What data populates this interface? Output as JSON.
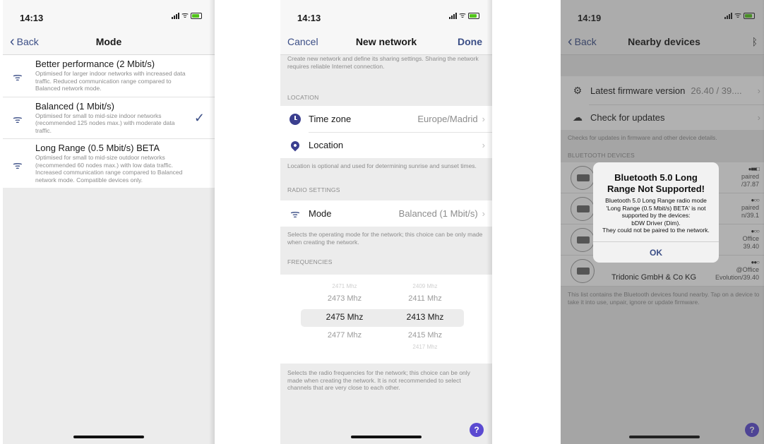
{
  "screen1": {
    "status_time": "14:13",
    "back_label": "Back",
    "title": "Mode",
    "modes": [
      {
        "title": "Better performance (2 Mbit/s)",
        "description": "Optimised for larger indoor networks with increased data traffic. Reduced communication range compared to Balanced network mode.",
        "selected": false
      },
      {
        "title": "Balanced (1 Mbit/s)",
        "description": "Optimised for small to mid-size indoor networks (recommended 125 nodes max.) with moderate data traffic.",
        "selected": true
      },
      {
        "title": "Long Range (0.5 Mbit/s) BETA",
        "description": "Optimised for small to mid-size outdoor networks (recommended 60 nodes max.) with low data traffic. Increased communication range compared to Balanced network mode. Compatible devices only.",
        "selected": false
      }
    ]
  },
  "screen2": {
    "status_time": "14:13",
    "cancel_label": "Cancel",
    "title": "New network",
    "done_label": "Done",
    "intro": "Create new network and define its sharing settings. Sharing the network requires reliable Internet connection.",
    "location_header": "LOCATION",
    "timezone_label": "Time zone",
    "timezone_value": "Europe/Madrid",
    "location_label": "Location",
    "location_note": "Location is optional and used for determining sunrise and sunset times.",
    "radio_header": "RADIO SETTINGS",
    "mode_label": "Mode",
    "mode_value": "Balanced (1 Mbit/s)",
    "mode_note": "Selects the operating mode for the network; this choice can be only made when creating the network.",
    "frequencies_header": "FREQUENCIES",
    "picker_left": [
      "2471 Mhz",
      "2473 Mhz",
      "2475 Mhz",
      "2477 Mhz",
      ""
    ],
    "picker_right": [
      "2409 Mhz",
      "2411 Mhz",
      "2413 Mhz",
      "2415 Mhz",
      "2417 Mhz"
    ],
    "frequencies_note": "Selects the radio frequencies for the network; this choice can be only made when creating the network. It is not recommended to select channels that are very close to each other.",
    "help_label": "?"
  },
  "screen3": {
    "status_time": "14:19",
    "back_label": "Back",
    "title": "Nearby devices",
    "firmware_label": "Latest firmware version",
    "firmware_value": "26.40 / 39....",
    "updates_label": "Check for updates",
    "updates_note": "Checks for updates in firmware and other device details.",
    "devices_header": "BLUETOOTH DEVICES",
    "devices": [
      {
        "name": "",
        "status": "paired",
        "version": "/37.87",
        "dots": "●■■□"
      },
      {
        "name": "",
        "status": "paired",
        "version": "n/39.1",
        "dots": "●○○"
      },
      {
        "name": "",
        "status": "Office",
        "version": "39.40",
        "dots": "●○○"
      },
      {
        "name": "Tridonic GmbH & Co KG",
        "status": "@Office",
        "version": "Evolution/39.40",
        "dots": "●●○"
      }
    ],
    "list_note": "This list contains the Bluetooth devices found nearby. Tap on a device to take it into use, unpair, ignore or update firmware.",
    "alert": {
      "title": "Bluetooth 5.0 Long Range Not Supported!",
      "message_line1": "Bluetooth 5.0 Long Range radio mode 'Long Range (0.5 Mbit/s) BETA' is not supported by the devices:",
      "message_device": "bDW Driver (Dim).",
      "message_line2": "They could not be paired to the network.",
      "ok_label": "OK"
    },
    "help_label": "?"
  }
}
